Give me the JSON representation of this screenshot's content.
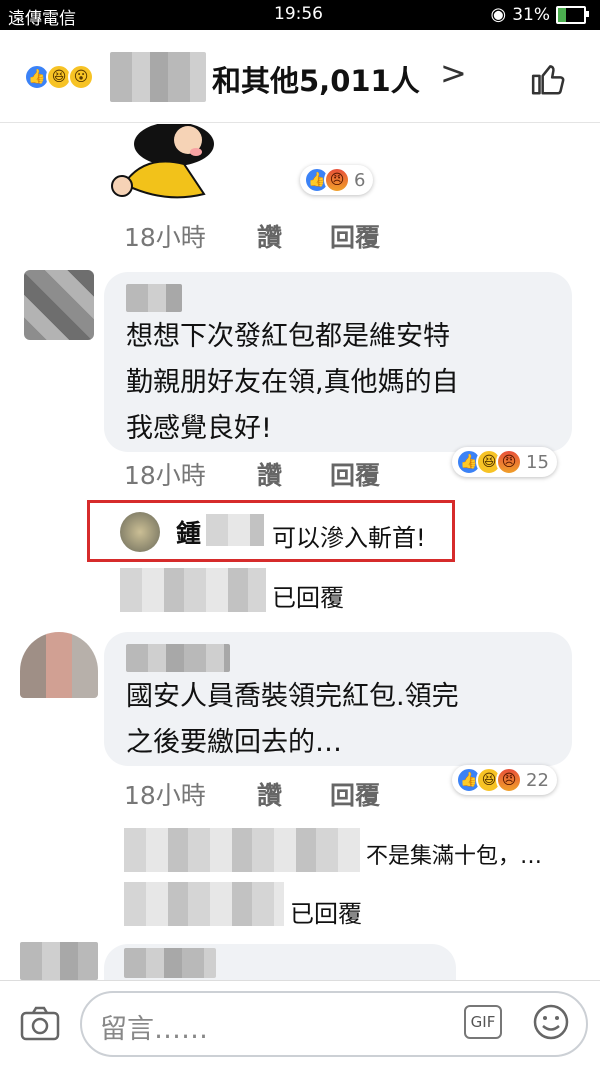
{
  "status": {
    "carrier": "遠傳電信",
    "time": "19:56",
    "battery_text": "31%",
    "battery_level": 0.31
  },
  "header": {
    "others_text": "和其他5,011人",
    "chevron": ">"
  },
  "comments": [
    {
      "time": "18小時",
      "like": "讚",
      "reply": "回覆",
      "reaction_count": "6"
    },
    {
      "text_lines": [
        "想想下次發紅包都是維安特",
        "勤親朋好友在領,真他媽的自",
        "我感覺良好!"
      ],
      "time": "18小時",
      "like": "讚",
      "reply": "回覆",
      "reaction_count": "15",
      "reply_preview": {
        "name": "鍾",
        "text": "可以滲入斬首!"
      },
      "replied_text": "已回覆"
    },
    {
      "text_lines": [
        "國安人員喬裝領完紅包.領完",
        "之後要繳回去的…"
      ],
      "time": "18小時",
      "like": "讚",
      "reply": "回覆",
      "reaction_count": "22",
      "reply_preview": {
        "text": "不是集滿十包，…"
      },
      "replied_text": "已回覆"
    }
  ],
  "composer": {
    "placeholder": "留言……",
    "gif": "GIF"
  },
  "colors": {
    "like_blue": "#3b82f6",
    "highlight_red": "#d62b2b"
  }
}
